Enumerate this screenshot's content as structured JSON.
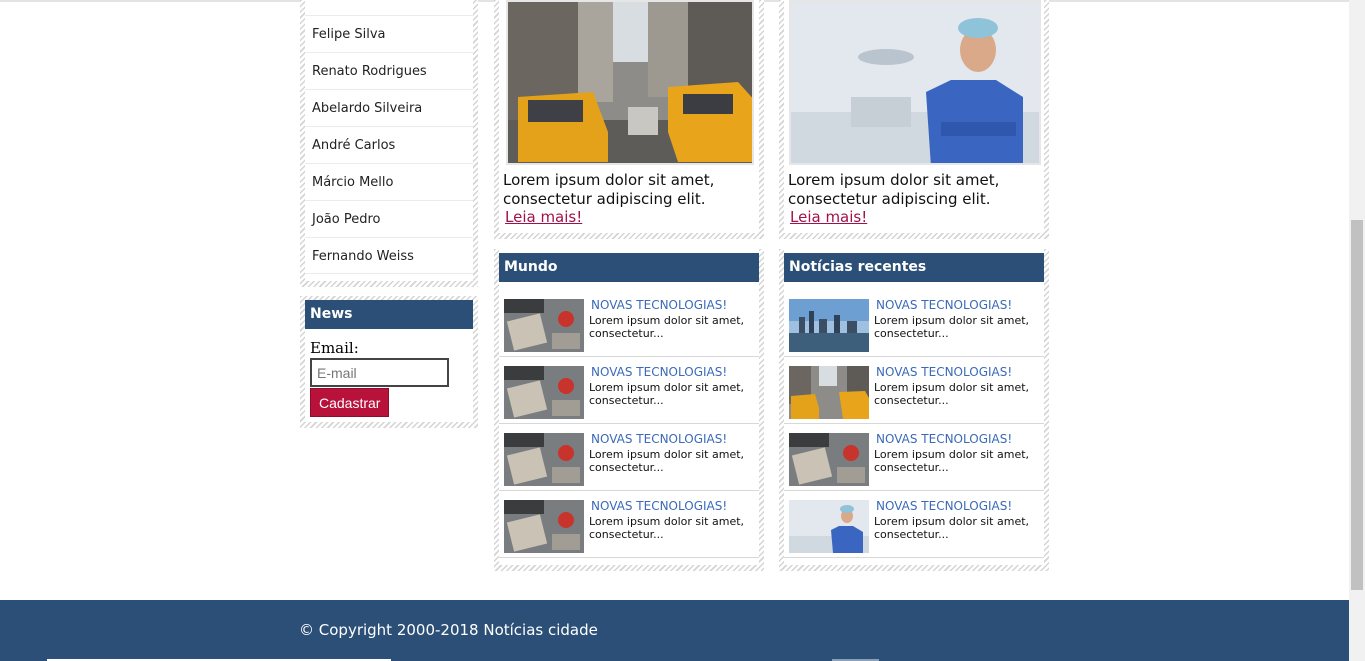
{
  "sidebar": {
    "authors": [
      "Felipe Silva",
      "Renato Rodrigues",
      "Abelardo Silveira",
      "André Carlos",
      "Márcio Mello",
      "João Pedro",
      "Fernando Weiss"
    ],
    "news_box": {
      "title": "News",
      "email_label": "Email:",
      "email_placeholder": "E-mail",
      "submit_label": "Cadastrar"
    }
  },
  "featured": [
    {
      "text": "Lorem ipsum dolor sit amet, consectetur adipiscing elit.",
      "link": "Leia mais!"
    },
    {
      "text": "Lorem ipsum dolor sit amet, consectetur adipiscing elit.",
      "link": "Leia mais!"
    }
  ],
  "sections": {
    "mundo": {
      "title": "Mundo",
      "items": [
        {
          "headline": "NOVAS TECNOLOGIAS!",
          "desc": "Lorem ipsum dolor sit amet, consectetur...",
          "thumb": "desk"
        },
        {
          "headline": "NOVAS TECNOLOGIAS!",
          "desc": "Lorem ipsum dolor sit amet, consectetur...",
          "thumb": "desk"
        },
        {
          "headline": "NOVAS TECNOLOGIAS!",
          "desc": "Lorem ipsum dolor sit amet, consectetur...",
          "thumb": "desk"
        },
        {
          "headline": "NOVAS TECNOLOGIAS!",
          "desc": "Lorem ipsum dolor sit amet, consectetur...",
          "thumb": "desk"
        }
      ]
    },
    "recentes": {
      "title": "Notícias recentes",
      "items": [
        {
          "headline": "NOVAS TECNOLOGIAS!",
          "desc": "Lorem ipsum dolor sit amet, consectetur...",
          "thumb": "skyline"
        },
        {
          "headline": "NOVAS TECNOLOGIAS!",
          "desc": "Lorem ipsum dolor sit amet, consectetur...",
          "thumb": "taxi"
        },
        {
          "headline": "NOVAS TECNOLOGIAS!",
          "desc": "Lorem ipsum dolor sit amet, consectetur...",
          "thumb": "desk"
        },
        {
          "headline": "NOVAS TECNOLOGIAS!",
          "desc": "Lorem ipsum dolor sit amet, consectetur...",
          "thumb": "doctor"
        }
      ]
    }
  },
  "footer": {
    "copyright": "© Copyright 2000-2018 Notícias cidade"
  },
  "colors": {
    "header_blue": "#2b4f76",
    "accent_red": "#b8113a",
    "link_red": "#a2124a",
    "headline_blue": "#3a6ab8"
  }
}
